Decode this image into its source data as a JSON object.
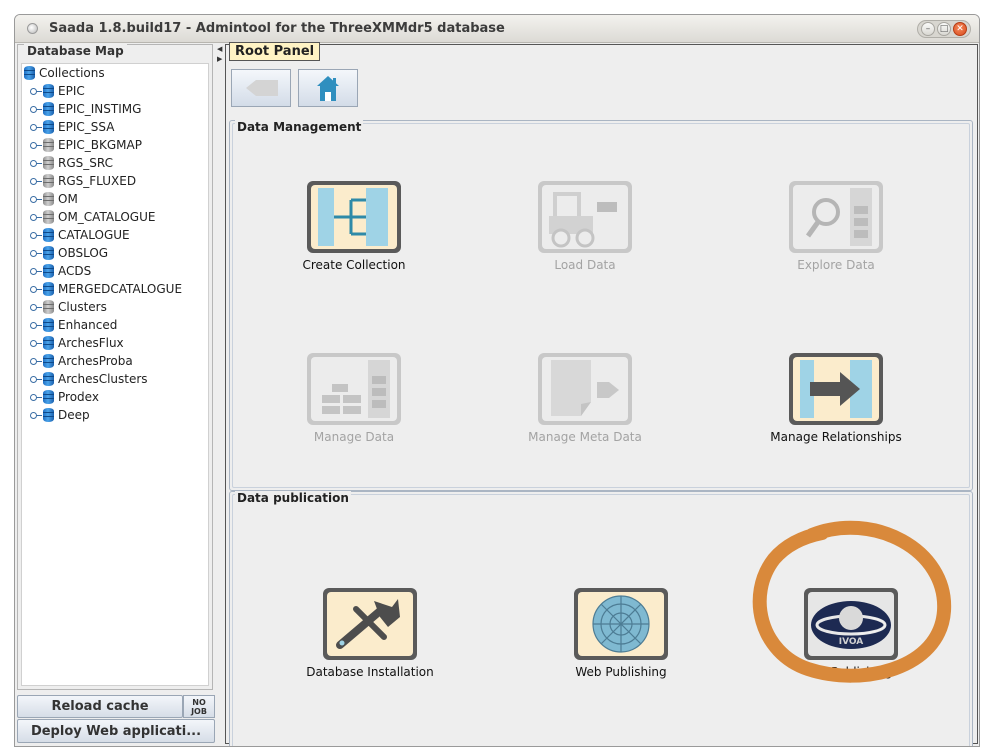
{
  "window": {
    "title": "Saada 1.8.build17 - Admintool for the ThreeXMMdr5 database",
    "controls": [
      "–",
      "□",
      "✕"
    ]
  },
  "left_panel": {
    "title": "Database Map",
    "root": "Collections",
    "items": [
      {
        "label": "EPIC",
        "icon": "database-icon",
        "color": "blue"
      },
      {
        "label": "EPIC_INSTIMG",
        "icon": "database-icon",
        "color": "blue"
      },
      {
        "label": "EPIC_SSA",
        "icon": "database-icon",
        "color": "blue"
      },
      {
        "label": "EPIC_BKGMAP",
        "icon": "database-icon",
        "color": "grey"
      },
      {
        "label": "RGS_SRC",
        "icon": "database-icon",
        "color": "grey"
      },
      {
        "label": "RGS_FLUXED",
        "icon": "database-icon",
        "color": "grey"
      },
      {
        "label": "OM",
        "icon": "database-icon",
        "color": "grey"
      },
      {
        "label": "OM_CATALOGUE",
        "icon": "database-icon",
        "color": "grey"
      },
      {
        "label": "CATALOGUE",
        "icon": "database-icon",
        "color": "blue"
      },
      {
        "label": "OBSLOG",
        "icon": "database-icon",
        "color": "blue"
      },
      {
        "label": "ACDS",
        "icon": "database-icon",
        "color": "blue"
      },
      {
        "label": "MERGEDCATALOGUE",
        "icon": "database-icon",
        "color": "blue"
      },
      {
        "label": "Clusters",
        "icon": "database-icon",
        "color": "grey"
      },
      {
        "label": "Enhanced",
        "icon": "database-icon",
        "color": "blue"
      },
      {
        "label": "ArchesFlux",
        "icon": "database-icon",
        "color": "blue"
      },
      {
        "label": "ArchesProba",
        "icon": "database-icon",
        "color": "blue"
      },
      {
        "label": "ArchesClusters",
        "icon": "database-icon",
        "color": "blue"
      },
      {
        "label": "Prodex",
        "icon": "database-icon",
        "color": "blue"
      },
      {
        "label": "Deep",
        "icon": "database-icon",
        "color": "blue"
      }
    ],
    "reload_button": "Reload cache",
    "job_badge_line1": "NO",
    "job_badge_line2": "JOB",
    "deploy_button": "Deploy Web applicati..."
  },
  "main_panel": {
    "title": "Root Panel",
    "back_icon": "back-arrow-icon",
    "home_icon": "home-icon",
    "data_management": {
      "title": "Data Management",
      "tiles": [
        {
          "label": "Create Collection",
          "enabled": true,
          "icon": "create-collection-icon"
        },
        {
          "label": "Load Data",
          "enabled": false,
          "icon": "forklift-icon"
        },
        {
          "label": "Explore Data",
          "enabled": false,
          "icon": "magnifier-icon"
        },
        {
          "label": "Manage Data",
          "enabled": false,
          "icon": "bricks-icon"
        },
        {
          "label": "Manage Meta Data",
          "enabled": false,
          "icon": "document-arrow-icon"
        },
        {
          "label": "Manage Relationships",
          "enabled": true,
          "icon": "relationship-arrow-icon"
        }
      ]
    },
    "data_publication": {
      "title": "Data publication",
      "tiles": [
        {
          "label": "Database Installation",
          "enabled": true,
          "icon": "wrench-icon"
        },
        {
          "label": "Web Publishing",
          "enabled": true,
          "icon": "web-globe-icon"
        },
        {
          "label": "VO Publishing",
          "enabled": true,
          "icon": "ivoa-logo-icon"
        }
      ]
    },
    "ivoa_logo_text": "IVOA"
  },
  "colors": {
    "tile_fill": "#fbeccc",
    "tile_blue": "#9fd3e6",
    "tile_dark": "#5a5a5a",
    "highlight_ring": "#d9893b",
    "root_legend_bg": "#fff3c4"
  }
}
